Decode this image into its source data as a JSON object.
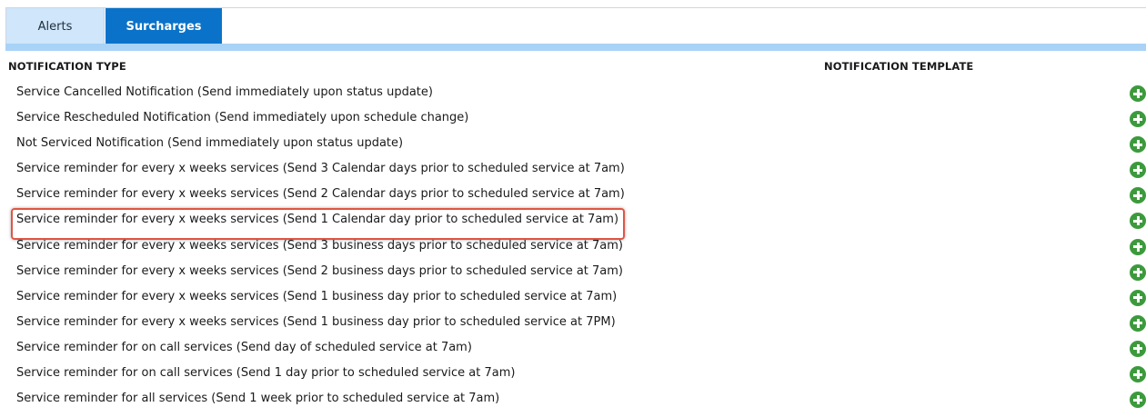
{
  "tabs": [
    {
      "label": "Alerts",
      "selected": false
    },
    {
      "label": "Surcharges",
      "selected": true
    }
  ],
  "table": {
    "columns": [
      "NOTIFICATION TYPE",
      "NOTIFICATION TEMPLATE"
    ],
    "rows": [
      {
        "label": "Service Cancelled Notification (Send immediately upon status update)",
        "action_icon": "add-icon"
      },
      {
        "label": "Service Rescheduled Notification (Send immediately upon schedule change)",
        "action_icon": "add-icon"
      },
      {
        "label": "Not Serviced Notification (Send immediately upon status update)",
        "action_icon": "add-icon"
      },
      {
        "label": "Service reminder for every x weeks services (Send 3 Calendar days prior to scheduled service at 7am)",
        "action_icon": "add-icon"
      },
      {
        "label": "Service reminder for every x weeks services (Send 2 Calendar days prior to scheduled service at 7am)",
        "action_icon": "add-icon"
      },
      {
        "label": "Service reminder for every x weeks services (Send 1 Calendar day prior to scheduled service at 7am)",
        "action_icon": "add-icon",
        "highlighted": true
      },
      {
        "label": "Service reminder for every x weeks services (Send 3 business days prior to scheduled service at 7am)",
        "action_icon": "add-icon"
      },
      {
        "label": "Service reminder for every x weeks services (Send 2 business days prior to scheduled service at 7am)",
        "action_icon": "add-icon"
      },
      {
        "label": "Service reminder for every x weeks services (Send 1 business day prior to scheduled service at 7am)",
        "action_icon": "add-icon"
      },
      {
        "label": "Service reminder for every x weeks services (Send 1 business day prior to scheduled service at 7PM)",
        "action_icon": "add-icon"
      },
      {
        "label": "Service reminder for on call services (Send day of scheduled service at 7am)",
        "action_icon": "add-icon"
      },
      {
        "label": "Service reminder for on call services (Send 1 day prior to scheduled service at 7am)",
        "action_icon": "add-icon"
      },
      {
        "label": "Service reminder for all services (Send 1 week prior to scheduled service at 7am)",
        "action_icon": "add-icon"
      }
    ]
  },
  "colors": {
    "tab_active_bg": "#0a73c9",
    "tab_inactive_bg": "#cfe6fb",
    "tab_strip": "#a9d2f7",
    "add_icon": "#3c9a3c",
    "highlight_border": "#e05545"
  }
}
